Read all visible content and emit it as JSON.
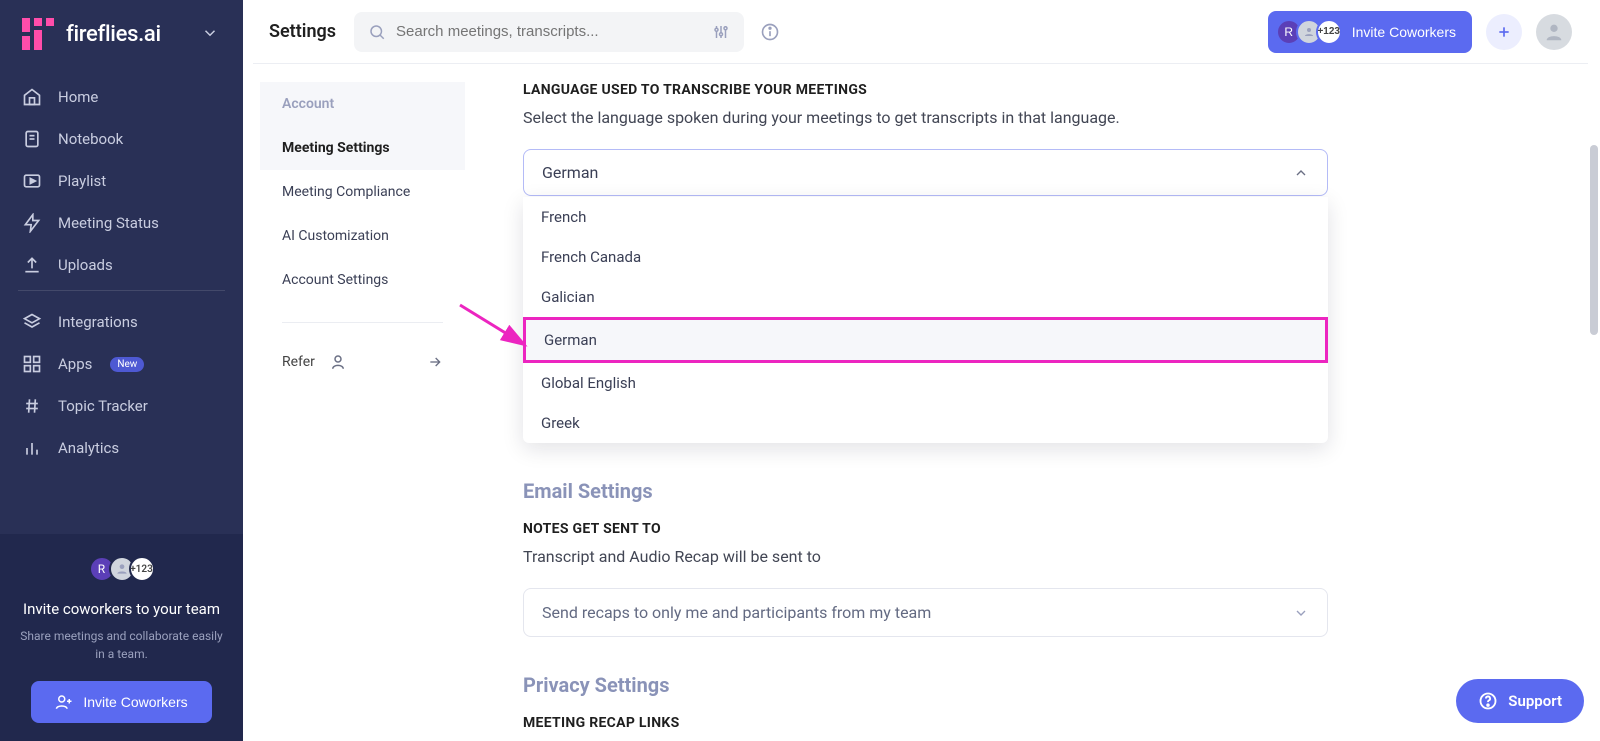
{
  "brand": {
    "name": "fireflies.ai"
  },
  "sidebar": {
    "items": [
      {
        "label": "Home"
      },
      {
        "label": "Notebook"
      },
      {
        "label": "Playlist"
      },
      {
        "label": "Meeting Status"
      },
      {
        "label": "Uploads"
      },
      {
        "label": "Integrations"
      },
      {
        "label": "Apps",
        "badge": "New"
      },
      {
        "label": "Topic Tracker"
      },
      {
        "label": "Analytics"
      }
    ],
    "footer": {
      "avatar_letter": "R",
      "avatar_more": "+123",
      "title": "Invite coworkers to your team",
      "subtitle": "Share meetings and collaborate easily in a team.",
      "button": "Invite Coworkers"
    }
  },
  "header": {
    "title": "Settings",
    "search_placeholder": "Search meetings, transcripts...",
    "invite_button": "Invite Coworkers",
    "avatar_letter": "R",
    "avatar_more": "+123"
  },
  "settings_nav": {
    "items": [
      "Account",
      "Meeting Settings",
      "Meeting Compliance",
      "AI Customization",
      "Account Settings"
    ],
    "refer": "Refer"
  },
  "language": {
    "heading": "LANGUAGE USED TO TRANSCRIBE YOUR MEETINGS",
    "description": "Select the language spoken during your meetings to get transcripts in that language.",
    "selected": "German",
    "options": [
      "French",
      "French Canada",
      "Galician",
      "German",
      "Global English",
      "Greek"
    ]
  },
  "email": {
    "title": "Email Settings",
    "heading": "NOTES GET SENT TO",
    "description": "Transcript and Audio Recap will be sent to",
    "selected": "Send recaps to only me and participants from my team"
  },
  "privacy": {
    "title": "Privacy Settings",
    "heading": "MEETING RECAP LINKS"
  },
  "support": {
    "label": "Support"
  },
  "colors": {
    "accent": "#5b6af0",
    "annotation": "#ec25c0"
  }
}
